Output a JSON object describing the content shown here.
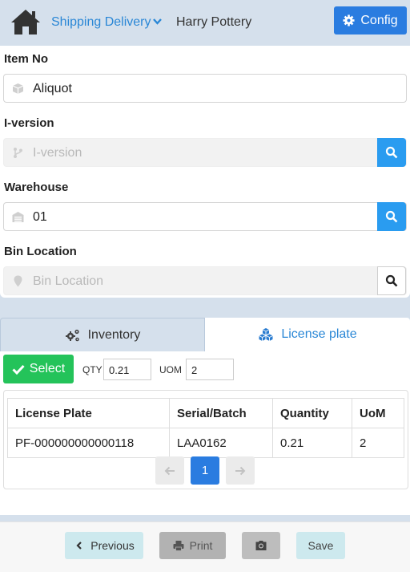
{
  "header": {
    "nav_title": "Shipping Delivery",
    "user_name": "Harry Pottery",
    "config_label": "Config"
  },
  "form": {
    "item_no": {
      "label": "Item No",
      "value": "Aliquot"
    },
    "i_version": {
      "label": "I-version",
      "placeholder": "I-version"
    },
    "warehouse": {
      "label": "Warehouse",
      "value": "01"
    },
    "bin_location": {
      "label": "Bin Location",
      "placeholder": "Bin Location"
    }
  },
  "tabs": {
    "inventory": "Inventory",
    "license_plate": "License plate"
  },
  "toolbar": {
    "select_label": "Select",
    "qty_label": "QTY",
    "qty_value": "0.21",
    "uom_label": "UOM",
    "uom_value": "2"
  },
  "table": {
    "headers": [
      "License Plate",
      "Serial/Batch",
      "Quantity",
      "UoM"
    ],
    "rows": [
      [
        "PF-000000000000118",
        "LAA0162",
        "0.21",
        "2"
      ]
    ]
  },
  "pagination": {
    "current_page": "1"
  },
  "footer": {
    "previous_label": "Previous",
    "print_label": "Print",
    "save_label": "Save"
  }
}
